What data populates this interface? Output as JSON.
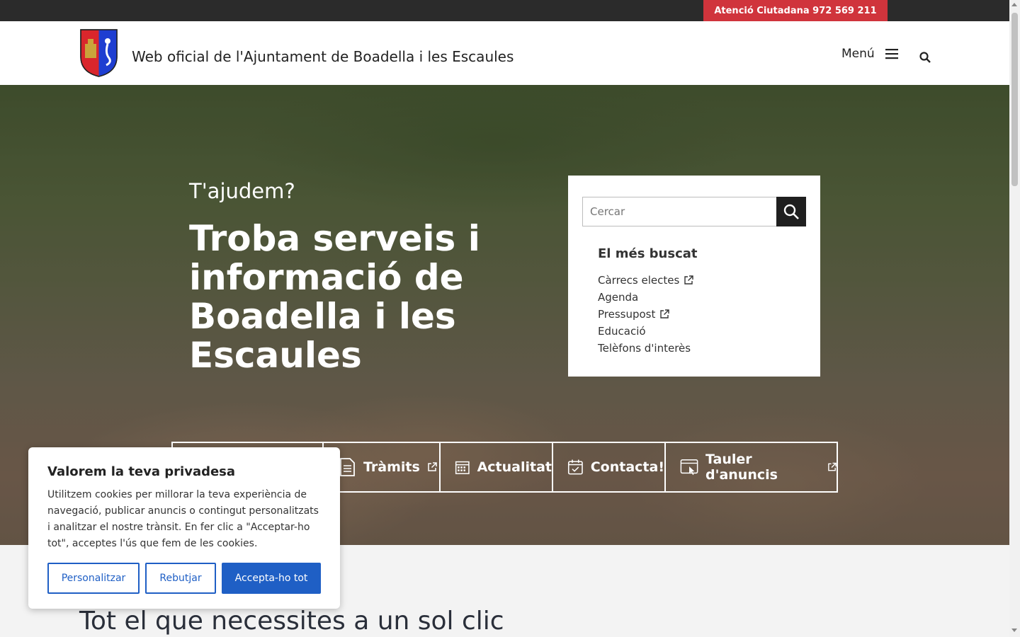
{
  "topbar": {
    "atencio_label": "Atenció Ciutadana 972 569 211"
  },
  "header": {
    "site_title": "Web oficial de l'Ajuntament de Boadella i les Escaules",
    "menu_label": "Menú",
    "logo_icon": "coat-of-arms-icon",
    "menu_icon": "hamburger-icon",
    "search_icon": "search-icon"
  },
  "hero": {
    "subtitle": "T'ajudem?",
    "title": "Troba serveis i informació de Boadella i les Escaules"
  },
  "search_card": {
    "placeholder": "Cercar",
    "popular_title": "El més buscat",
    "items": [
      {
        "label": "Càrrecs electes",
        "external": true
      },
      {
        "label": "Agenda",
        "external": false
      },
      {
        "label": "Pressupost",
        "external": true
      },
      {
        "label": "Educació",
        "external": false
      },
      {
        "label": "Telèfons d'interès",
        "external": false
      }
    ]
  },
  "quick_links": [
    {
      "label": "",
      "icon": "hidden-icon",
      "external": false
    },
    {
      "label": "Tràmits",
      "icon": "document-icon",
      "external": true
    },
    {
      "label": "Actualitat",
      "icon": "calendar-icon",
      "external": false
    },
    {
      "label": "Contacta!",
      "icon": "calendar-check-icon",
      "external": false
    },
    {
      "label": "Tauler d'anuncis",
      "icon": "web-board-icon",
      "external": true
    }
  ],
  "section": {
    "title": "Tot el que necessites a un sol clic"
  },
  "cookie": {
    "title": "Valorem la teva privadesa",
    "text": "Utilitzem cookies per millorar la teva experiència de navegació, publicar anuncis o contingut personalitzats i analitzar el nostre trànsit. En fer clic a \"Acceptar-ho tot\", acceptes l'ús que fem de les cookies.",
    "customize_label": "Personalitzar",
    "reject_label": "Rebutjar",
    "accept_label": "Accepta-ho tot"
  },
  "colors": {
    "accent_red": "#d0343c",
    "accent_blue": "#1f5fc5",
    "dark": "#2b2b2b"
  }
}
